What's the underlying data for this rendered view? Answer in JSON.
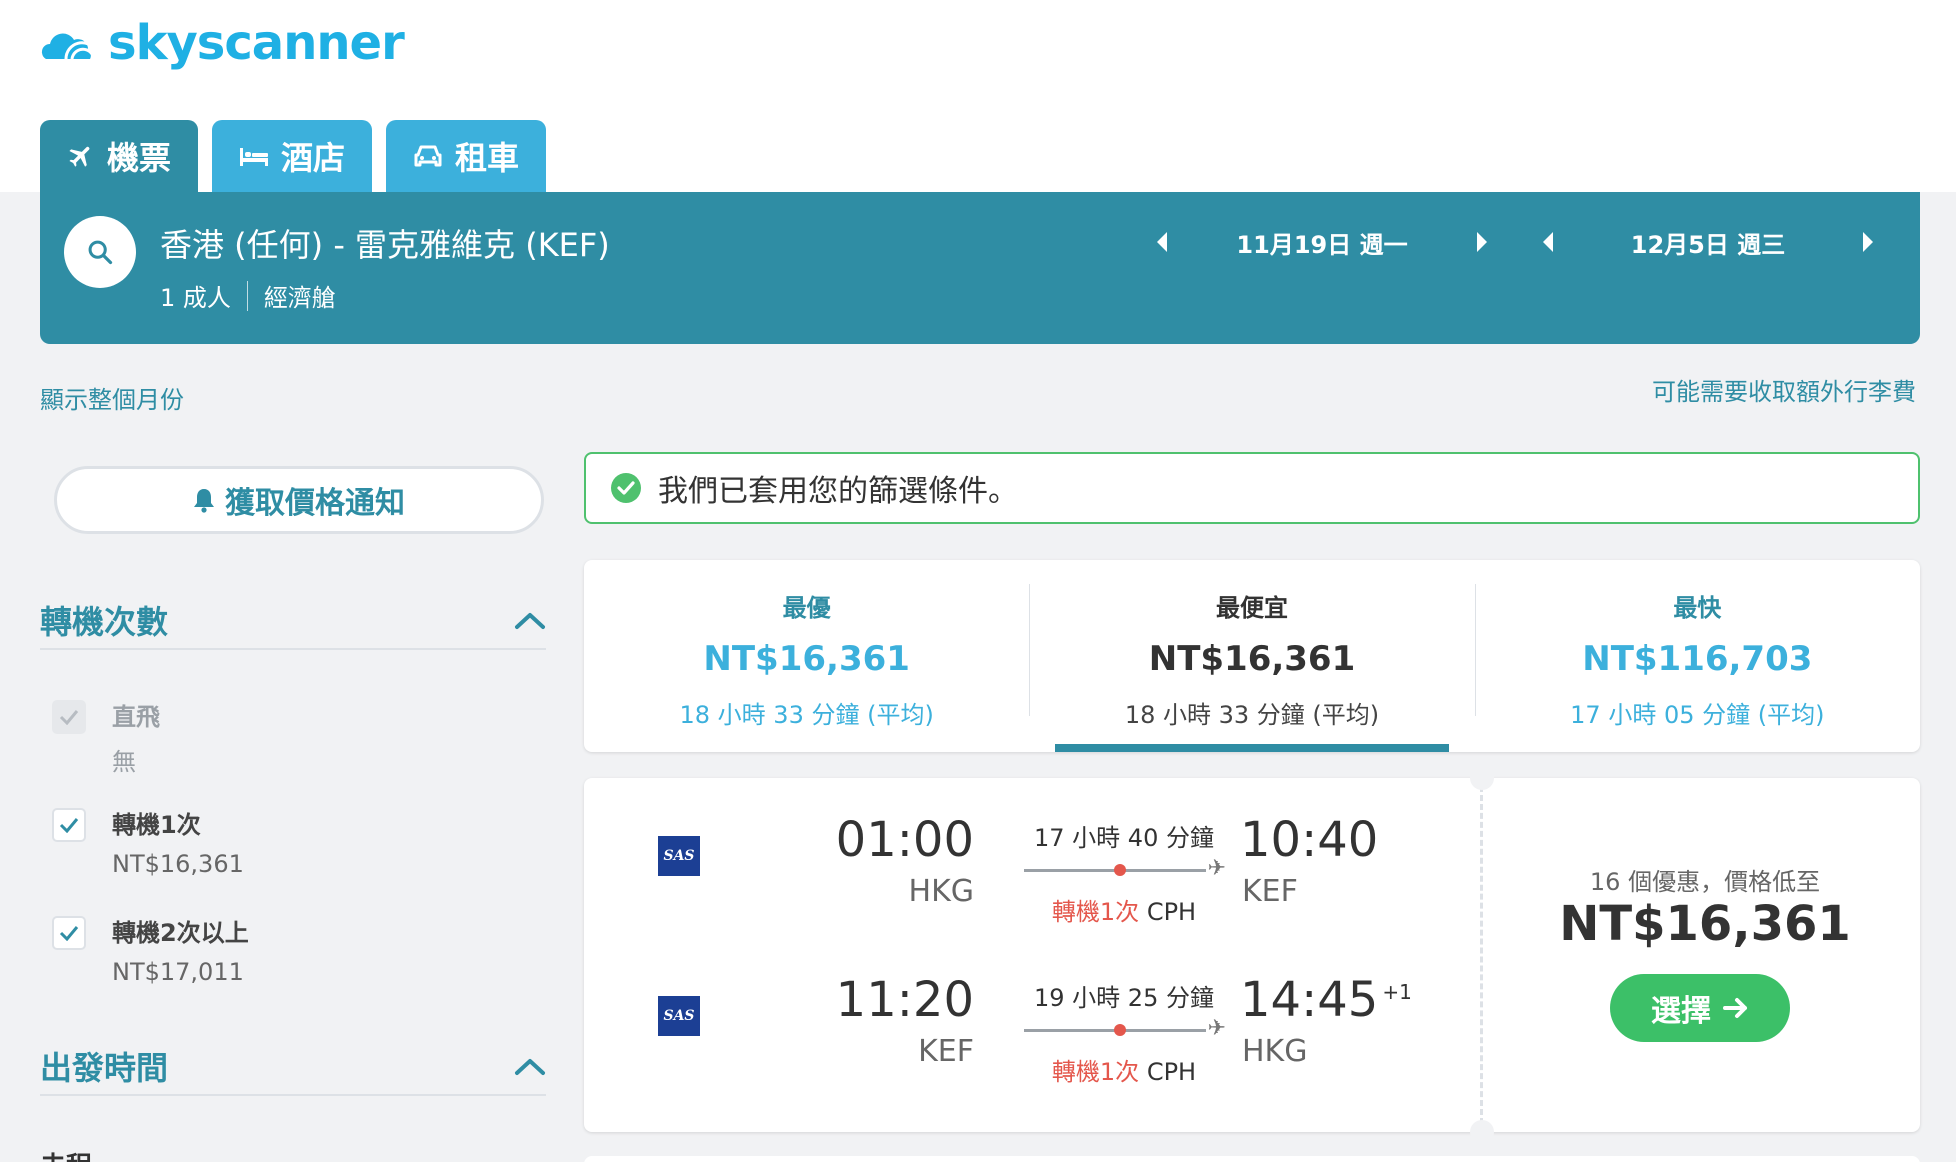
{
  "brand": {
    "name": "skyscanner",
    "color": "#1fb0e4",
    "logo_icon": "skyscanner-cloud-icon"
  },
  "tabs": [
    {
      "label": "機票",
      "icon": "plane-icon",
      "active": true
    },
    {
      "label": "酒店",
      "icon": "bed-icon",
      "active": false
    },
    {
      "label": "租車",
      "icon": "car-icon",
      "active": false
    }
  ],
  "search": {
    "route": "香港 (任何) - 雷克雅維克 (KEF)",
    "passengers": "1 成人",
    "cabin": "經濟艙",
    "outbound_date": "11月19日 週一",
    "return_date": "12月5日 週三"
  },
  "links": {
    "whole_month": "顯示整個月份",
    "baggage_fees": "可能需要收取額外行李費"
  },
  "price_alert": {
    "label": "獲取價格通知",
    "icon": "bell-icon"
  },
  "filters": {
    "stops": {
      "title": "轉機次數",
      "options": [
        {
          "label": "直飛",
          "sub": "無",
          "checked": true,
          "disabled": true
        },
        {
          "label": "轉機1次",
          "sub": "NT$16,361",
          "checked": true,
          "disabled": false
        },
        {
          "label": "轉機2次以上",
          "sub": "NT$17,011",
          "checked": true,
          "disabled": false
        }
      ]
    },
    "departure_time": {
      "title": "出發時間",
      "next_label": "去程"
    }
  },
  "notice": {
    "text": "我們已套用您的篩選條件。",
    "icon": "check-circle-icon",
    "color": "#4fc16e"
  },
  "sort_tabs": [
    {
      "title": "最優",
      "price": "NT$16,361",
      "duration": "18 小時 33 分鐘 (平均)",
      "selected": false
    },
    {
      "title": "最便宜",
      "price": "NT$16,361",
      "duration": "18 小時 33 分鐘 (平均)",
      "selected": true
    },
    {
      "title": "最快",
      "price": "NT$116,703",
      "duration": "17 小時 05 分鐘 (平均)",
      "selected": false
    }
  ],
  "result": {
    "legs": [
      {
        "airline": "SAS",
        "dep_time": "01:00",
        "dep_airport": "HKG",
        "duration": "17 小時 40 分鐘",
        "stops": "轉機1次",
        "via": "CPH",
        "arr_time": "10:40",
        "arr_airport": "KEF",
        "plus_day": ""
      },
      {
        "airline": "SAS",
        "dep_time": "11:20",
        "dep_airport": "KEF",
        "duration": "19 小時 25 分鐘",
        "stops": "轉機1次",
        "via": "CPH",
        "arr_time": "14:45",
        "arr_airport": "HKG",
        "plus_day": "+1"
      }
    ],
    "deals": "16 個優惠，價格低至",
    "price": "NT$16,361",
    "select_label": "選擇"
  },
  "colors": {
    "primary": "#2f8da4",
    "secondary": "#3cb0dc",
    "success": "#3cc068",
    "stop_red": "#e4574c"
  }
}
